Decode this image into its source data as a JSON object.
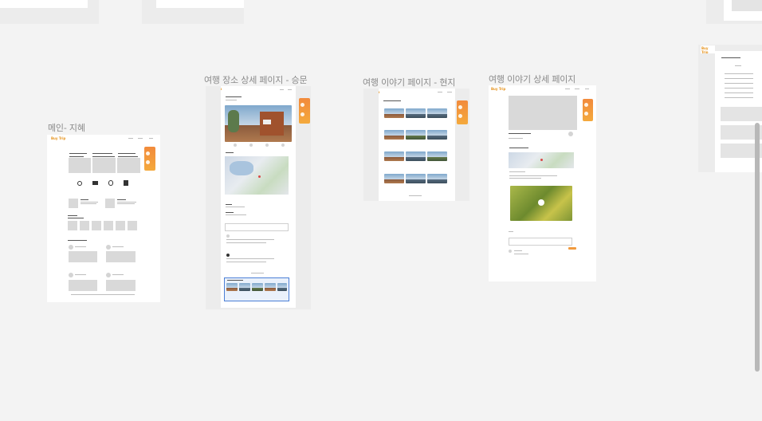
{
  "canvas": {
    "frames": [
      {
        "id": "main",
        "label": "메인- 지혜"
      },
      {
        "id": "place-detail",
        "label": "여행 장소 상세 페이지 - 승문"
      },
      {
        "id": "story",
        "label": "여행 이야기 페이지 - 현지"
      },
      {
        "id": "story-detail",
        "label": "여행 이야기 상세 페이지"
      }
    ]
  },
  "colors": {
    "canvas_bg": "#f3f3f3",
    "accent": "#f19a3e",
    "selection": "#4b7fd6"
  },
  "icons": {
    "scrollbar": "vertical-scrollbar"
  }
}
